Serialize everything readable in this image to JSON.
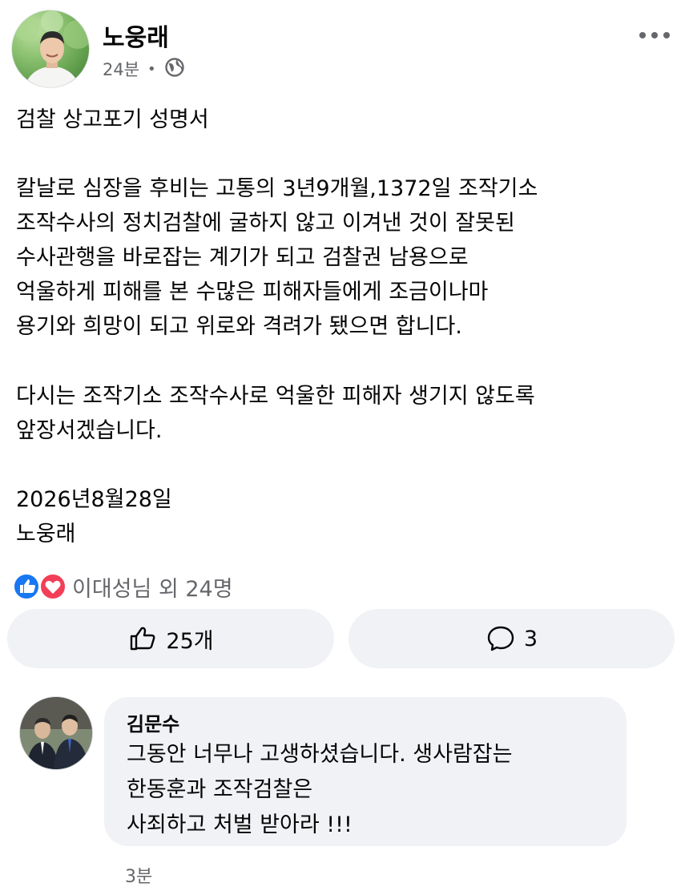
{
  "post": {
    "author": "노웅래",
    "time": "24분",
    "separator": "•",
    "privacy_icon": "globe-icon",
    "more_icon": "more-dots-icon",
    "paragraphs": [
      "검찰 상고포기 성명서",
      "칼날로 심장을 후비는 고통의 3년9개월,1372일 조작기소\n조작수사의 정치검찰에 굴하지 않고 이겨낸 것이 잘못된\n수사관행을 바로잡는 계기가 되고 검찰권 남용으로\n억울하게 피해를 본 수많은 피해자들에게 조금이나마\n용기와 희망이 되고 위로와 격려가 됐으면 합니다.",
      "다시는 조작기소 조작수사로 억울한 피해자 생기지 않도록\n앞장서겠습니다.",
      "2026년8월28일\n노웅래"
    ]
  },
  "reactions": {
    "text": "이대성님 외 24명",
    "icons": [
      "like-reaction-icon",
      "love-reaction-icon"
    ],
    "like_color": "#1877f2",
    "love_color": "#f33e58"
  },
  "actions": {
    "like_label": "25개",
    "comment_label": "3"
  },
  "comment": {
    "author": "김문수",
    "text": "그동안 너무나 고생하셨습니다. 생사람잡는\n한동훈과 조작검찰은\n사죄하고 처벌 받아라 !!!",
    "time": "3분"
  },
  "colors": {
    "text": "#050505",
    "secondary": "#65676b",
    "surface": "#f0f2f5"
  }
}
